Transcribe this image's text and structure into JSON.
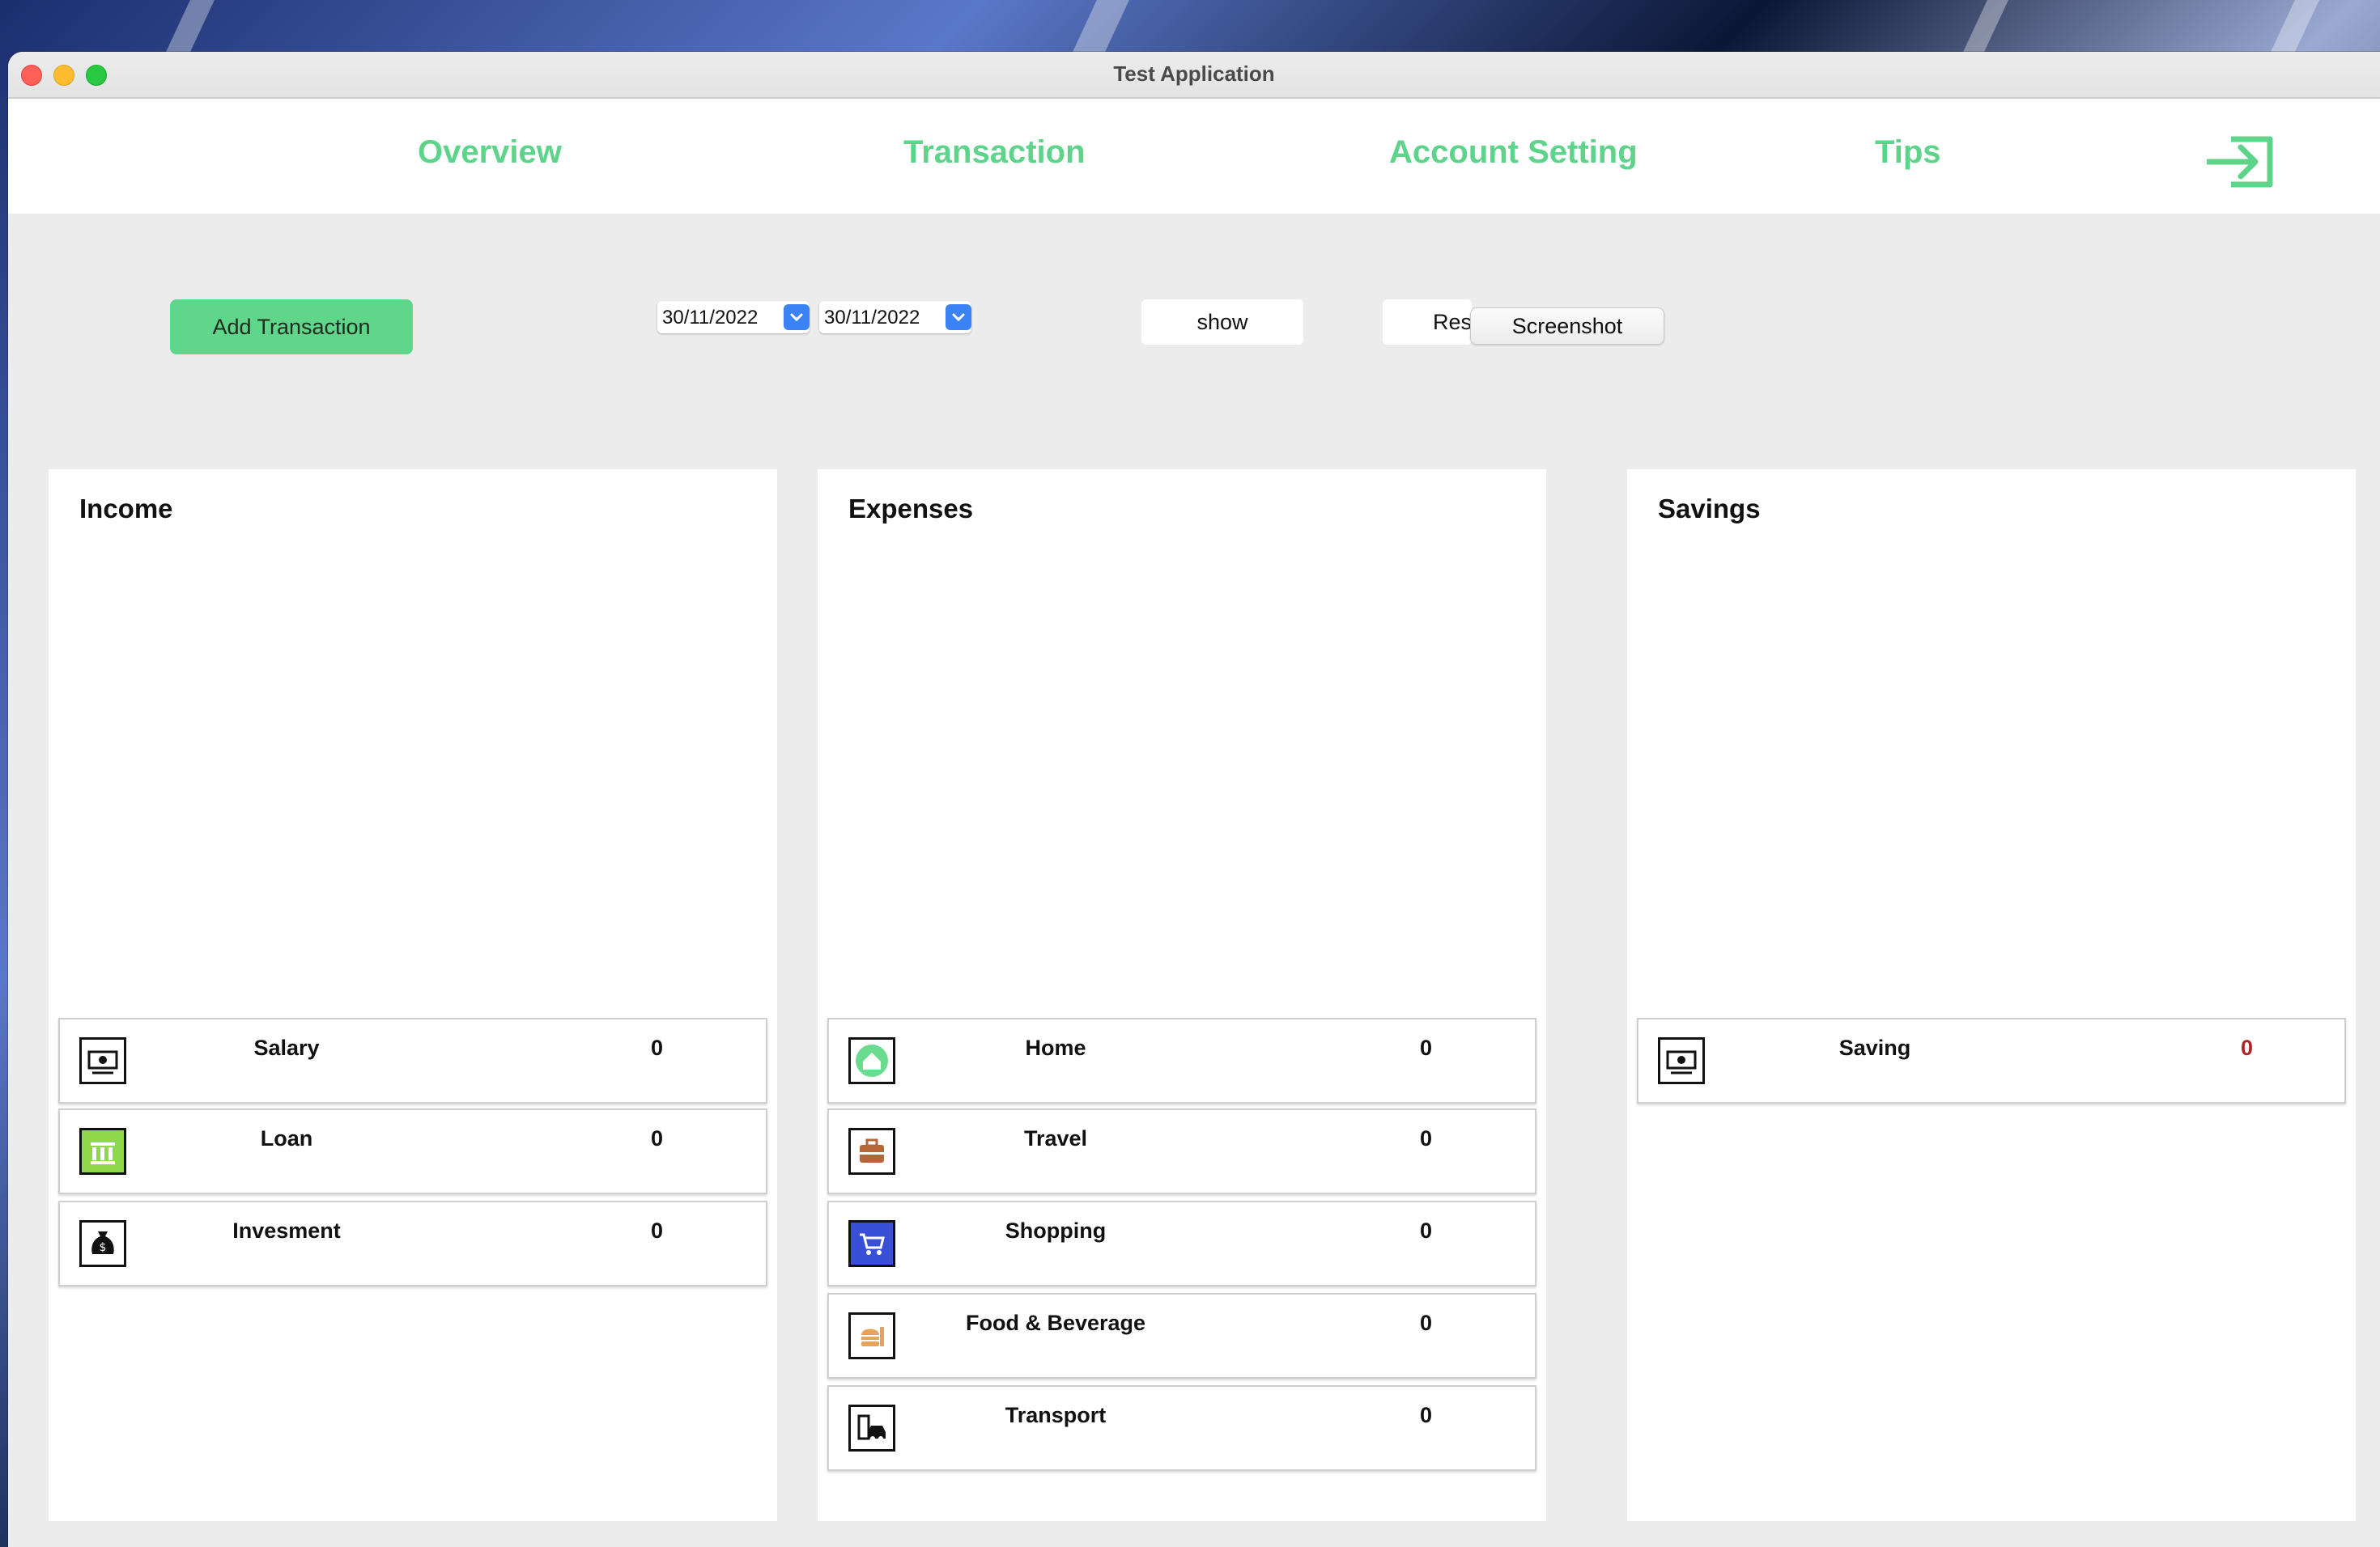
{
  "window": {
    "title": "Test Application"
  },
  "nav": {
    "tabs": [
      {
        "label": "Overview"
      },
      {
        "label": "Transaction"
      },
      {
        "label": "Account Setting"
      },
      {
        "label": "Tips"
      }
    ],
    "logout_icon": "logout-arrow-icon"
  },
  "toolbar": {
    "add_transaction_label": "Add Transaction",
    "date_from": "30/11/2022",
    "date_to": "30/11/2022",
    "show_label": "show",
    "reset_label": "Res",
    "screenshot_label": "Screenshot"
  },
  "colors": {
    "accent": "#5ed48a",
    "date_caret": "#3b82f6",
    "negative_value": "#b22222"
  },
  "panels": {
    "income": {
      "title": "Income",
      "items": [
        {
          "label": "Salary",
          "value": "0",
          "icon": "cash-icon"
        },
        {
          "label": "Loan",
          "value": "0",
          "icon": "bank-icon"
        },
        {
          "label": "Invesment",
          "value": "0",
          "icon": "money-bag-icon"
        }
      ]
    },
    "expenses": {
      "title": "Expenses",
      "items": [
        {
          "label": "Home",
          "value": "0",
          "icon": "house-icon"
        },
        {
          "label": "Travel",
          "value": "0",
          "icon": "suitcase-icon"
        },
        {
          "label": "Shopping",
          "value": "0",
          "icon": "shopping-cart-icon"
        },
        {
          "label": "Food & Beverage",
          "value": "0",
          "icon": "burger-drink-icon"
        },
        {
          "label": "Transport",
          "value": "0",
          "icon": "car-fuel-icon"
        }
      ]
    },
    "savings": {
      "title": "Savings",
      "items": [
        {
          "label": "Saving",
          "value": "0",
          "icon": "cash-icon"
        }
      ]
    }
  }
}
